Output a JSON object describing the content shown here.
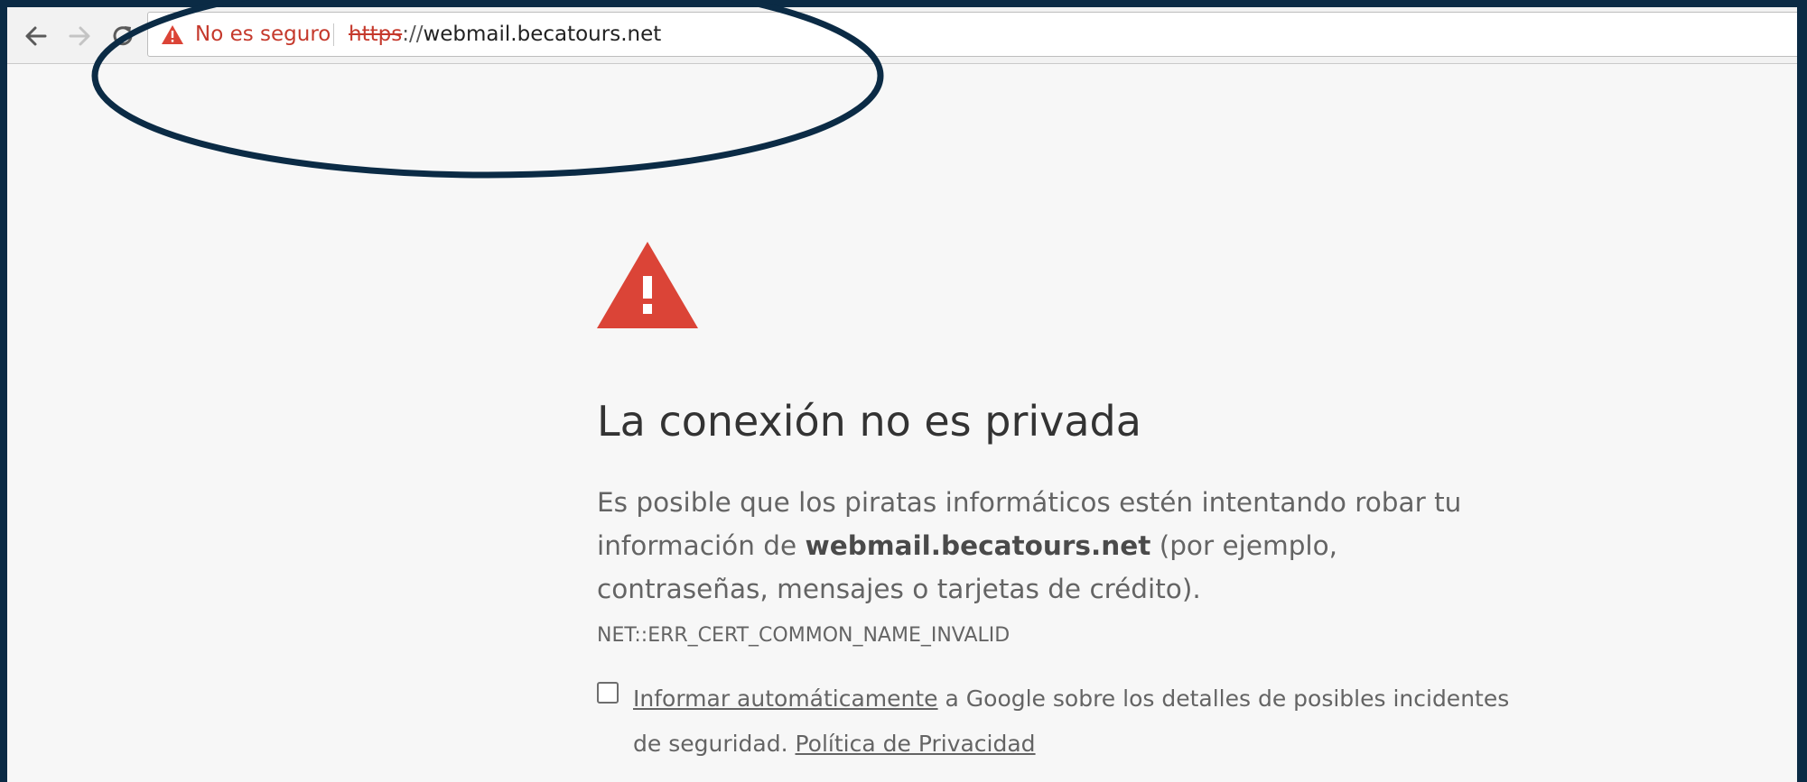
{
  "browser": {
    "security_label": "No es seguro",
    "url_scheme": "https",
    "url_separator": "://",
    "url_host": "webmail.becatours.net"
  },
  "interstitial": {
    "heading": "La conexión no es privada",
    "desc_part1": "Es posible que los piratas informáticos estén intentando robar tu información de ",
    "desc_host": "webmail.becatours.net",
    "desc_part2": " (por ejemplo, contraseñas, mensajes o tarjetas de crédito). ",
    "error_code": "NET::ERR_CERT_COMMON_NAME_INVALID",
    "optin_link1": "Informar automáticamente",
    "optin_mid": " a Google sobre los detalles de posibles incidentes de seguridad. ",
    "optin_link2": "Política de Privacidad"
  },
  "colors": {
    "warning_red": "#db4437",
    "insecure_text": "#c5392c",
    "annotation_ring": "#0b2b45",
    "page_background": "#f7f7f7"
  },
  "icons": [
    "back-arrow-icon",
    "forward-arrow-icon",
    "reload-icon",
    "warning-triangle-icon"
  ]
}
